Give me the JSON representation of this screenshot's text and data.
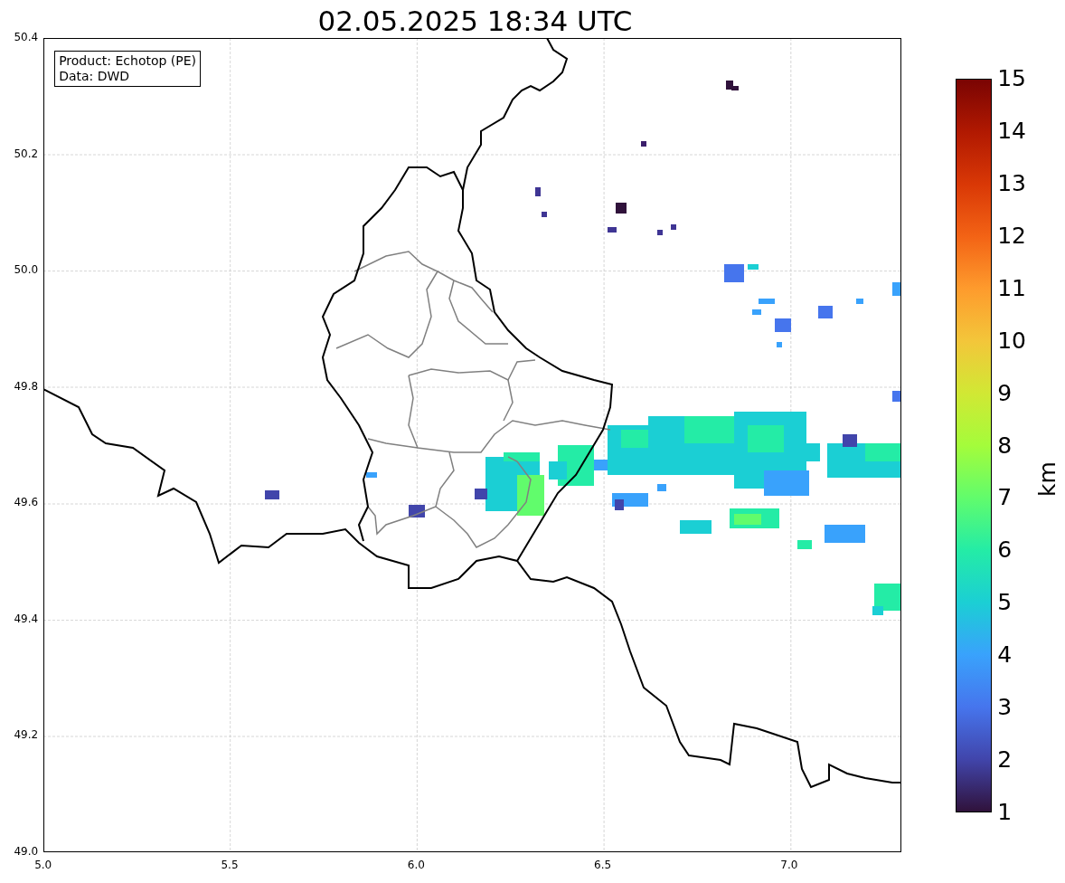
{
  "title": "02.05.2025 18:34 UTC",
  "info_box": {
    "lines": [
      "Product: Echotop (PE)",
      "Data: DWD"
    ]
  },
  "map": {
    "x_tick_labels": [
      "5.0",
      "5.5",
      "6.0",
      "6.5",
      "7.0"
    ],
    "y_tick_labels": [
      "50.4",
      "50.2",
      "50.0",
      "49.8",
      "49.6",
      "49.4",
      "49.2",
      "49.0"
    ]
  },
  "colorbar": {
    "label": "km",
    "tick_labels": [
      "15",
      "14",
      "13",
      "12",
      "11",
      "10",
      "9",
      "8",
      "7",
      "6",
      "5",
      "4",
      "3",
      "2",
      "1"
    ]
  }
}
